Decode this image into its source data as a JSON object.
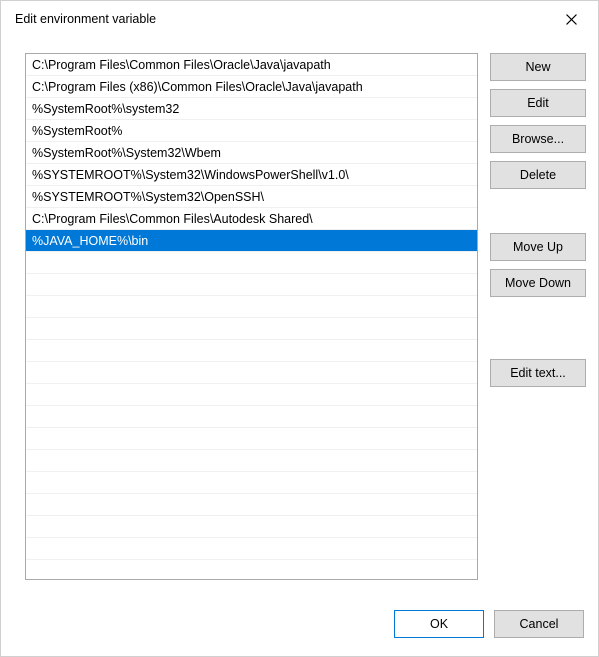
{
  "window": {
    "title": "Edit environment variable"
  },
  "list": {
    "items": [
      "C:\\Program Files\\Common Files\\Oracle\\Java\\javapath",
      "C:\\Program Files (x86)\\Common Files\\Oracle\\Java\\javapath",
      "%SystemRoot%\\system32",
      "%SystemRoot%",
      "%SystemRoot%\\System32\\Wbem",
      "%SYSTEMROOT%\\System32\\WindowsPowerShell\\v1.0\\",
      "%SYSTEMROOT%\\System32\\OpenSSH\\",
      "C:\\Program Files\\Common Files\\Autodesk Shared\\",
      "%JAVA_HOME%\\bin"
    ],
    "selected_index": 8
  },
  "buttons": {
    "new": "New",
    "edit": "Edit",
    "browse": "Browse...",
    "delete": "Delete",
    "move_up": "Move Up",
    "move_down": "Move Down",
    "edit_text": "Edit text...",
    "ok": "OK",
    "cancel": "Cancel"
  }
}
